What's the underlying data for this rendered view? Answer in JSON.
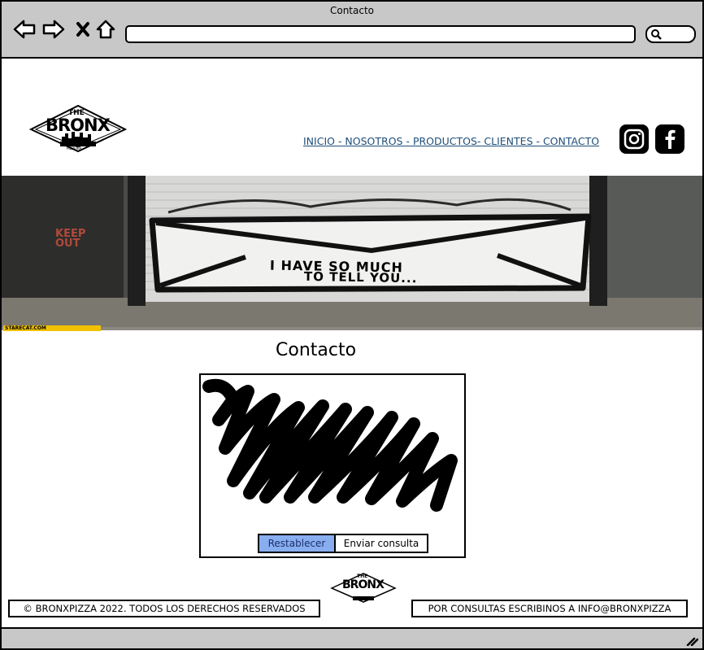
{
  "browser": {
    "window_title": "Contacto",
    "url": "",
    "icons": [
      "back-arrow-icon",
      "forward-arrow-icon",
      "close-x-icon",
      "home-icon",
      "search-icon",
      "resize-grip-icon"
    ]
  },
  "header": {
    "logo_text": "BRONX",
    "logo_top": "THE",
    "logo_bottom": "PIZZERIA",
    "nav_text": "INICIO - NOSOTROS - PRODUCTOS- CLIENTES - CONTACTO",
    "social": [
      "instagram-icon",
      "facebook-icon"
    ]
  },
  "hero": {
    "line1": "I HAVE SO MUCH",
    "line2": "TO TELL YOU...",
    "graffiti": "KEEP OUT",
    "credit": "STARECAT.COM"
  },
  "main": {
    "title": "Contacto",
    "reset_label": "Restablecer",
    "send_label": "Enviar consulta"
  },
  "footer": {
    "copyright": "© BRONXPIZZA 2022. TODOS LOS DERECHOS RESERVADOS",
    "contact": "POR CONSULTAS ESCRIBINOS A INFO@BRONXPIZZA"
  },
  "colors": {
    "chrome": "#c8c8c8",
    "link": "#1f4e79",
    "reset_button": "#89aef0"
  }
}
